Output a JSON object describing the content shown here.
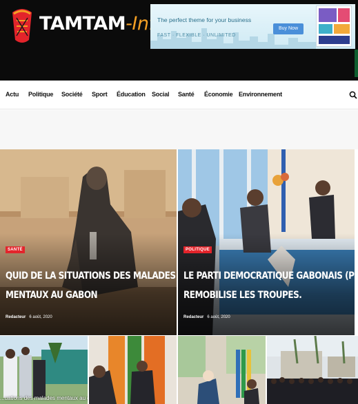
{
  "header": {
    "logo_word": "TAMTAM",
    "logo_sep": "-",
    "logo_suffix": "Info"
  },
  "ad": {
    "line1": "The perfect theme for your business",
    "line2": "FAST · FLEXIBLE · UNLIMITED",
    "button": "Buy Now"
  },
  "nav": {
    "items": [
      "Actu",
      "Politique",
      "Société",
      "Sport",
      "Éducation",
      "Social",
      "Santé",
      "Économie",
      "Environnement"
    ]
  },
  "featured": [
    {
      "category": "SANTÉ",
      "title_line1": "QUID DE LA SITUATIONS DES MALADES",
      "title_line2": "MENTAUX AU GABON",
      "author": "Redacteur",
      "date": "6 août, 2020"
    },
    {
      "category": "POLITIQUE",
      "title_line1": "LE PARTI DEMOCRATIQUE GABONAIS (PDG),",
      "title_line2": "REMOBILISE LES TROUPES.",
      "author": "Redacteur",
      "date": "6 août, 2020"
    }
  ],
  "thumbs": [
    {
      "caption": "...uations des malades mentaux au gabon"
    }
  ],
  "colors": {
    "header_bg": "#0b0b0b",
    "logo_accent": "#f4a024",
    "badge_red": "#e3242b"
  }
}
